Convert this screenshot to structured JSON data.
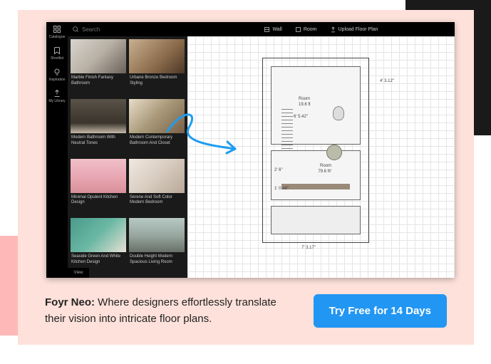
{
  "sidebar": {
    "items": [
      {
        "label": "Catalogue"
      },
      {
        "label": "Shortlist"
      },
      {
        "label": "Inspiration"
      },
      {
        "label": "My Library"
      }
    ]
  },
  "search": {
    "placeholder": "Search"
  },
  "toolbar": {
    "wall": "Wall",
    "room": "Room",
    "upload": "Upload Floor Plan"
  },
  "catalog": [
    {
      "label": "Marble Finish Fantasy Bathroom"
    },
    {
      "label": "Urbane Bronze Bedroom Styling"
    },
    {
      "label": "Modern Bathroom With Neutral Tones"
    },
    {
      "label": "Modern Contemporary Bathroom And Closet"
    },
    {
      "label": "Minimal Opulent Kitchen Design"
    },
    {
      "label": "Serene And Soft Color Modern Bedroom"
    },
    {
      "label": "Seaside Green And White Kitchen Design"
    },
    {
      "label": "Double Height Modern Spacious Living Room"
    }
  ],
  "view_btn": "View",
  "floorplan": {
    "room1_label": "Room",
    "room1_dim": "19.6 ft",
    "dim_right": "4' 3.12\"",
    "dim_mid": "6' 5.42\"",
    "room2_label": "Room",
    "room2_area": "79.6 ft²",
    "dim_left": "2' 6\"",
    "dim_small": "1' 0.48\"",
    "dim_bottom": "7' 3.17\""
  },
  "promo": {
    "brand": "Foyr Neo:",
    "text": " Where designers effortlessly translate their vision into intricate floor plans.",
    "cta": "Try Free for 14 Days"
  },
  "colors": {
    "accent": "#2196f3",
    "pink_bg": "#fde1da"
  }
}
